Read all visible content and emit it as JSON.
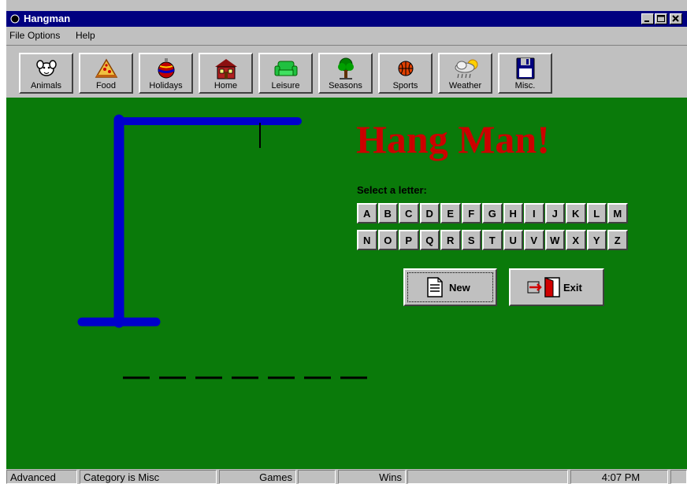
{
  "window": {
    "title": "Hangman"
  },
  "menu": [
    {
      "label": "File"
    },
    {
      "label": "Options"
    },
    {
      "label": "Help"
    }
  ],
  "toolbar": [
    {
      "label": "Animals",
      "icon": "animal-icon"
    },
    {
      "label": "Food",
      "icon": "pizza-icon"
    },
    {
      "label": "Holidays",
      "icon": "ornament-icon"
    },
    {
      "label": "Home",
      "icon": "house-icon"
    },
    {
      "label": "Leisure",
      "icon": "couch-icon"
    },
    {
      "label": "Seasons",
      "icon": "tree-icon"
    },
    {
      "label": "Sports",
      "icon": "basketball-icon"
    },
    {
      "label": "Weather",
      "icon": "sun-cloud-icon"
    },
    {
      "label": "Misc.",
      "icon": "floppy-disk-icon"
    }
  ],
  "game": {
    "title": "Hang Man!",
    "select_label": "Select a letter:",
    "letters_row1": [
      "A",
      "B",
      "C",
      "D",
      "E",
      "F",
      "G",
      "H",
      "I",
      "J",
      "K",
      "L",
      "M"
    ],
    "letters_row2": [
      "N",
      "O",
      "P",
      "Q",
      "R",
      "S",
      "T",
      "U",
      "V",
      "W",
      "X",
      "Y",
      "Z"
    ],
    "word_length": 7,
    "new_label": "New",
    "exit_label": "Exit"
  },
  "statusbar": {
    "mode": "Advanced",
    "category": "Category is Misc",
    "games_label": "Games",
    "games_value": "",
    "wins_label": "Wins",
    "wins_value": "",
    "time": "4:07 PM"
  },
  "colors": {
    "game_background": "#0a7a0a",
    "gallows": "#0000cc",
    "title_red": "#cc0000",
    "titlebar": "#000080"
  }
}
